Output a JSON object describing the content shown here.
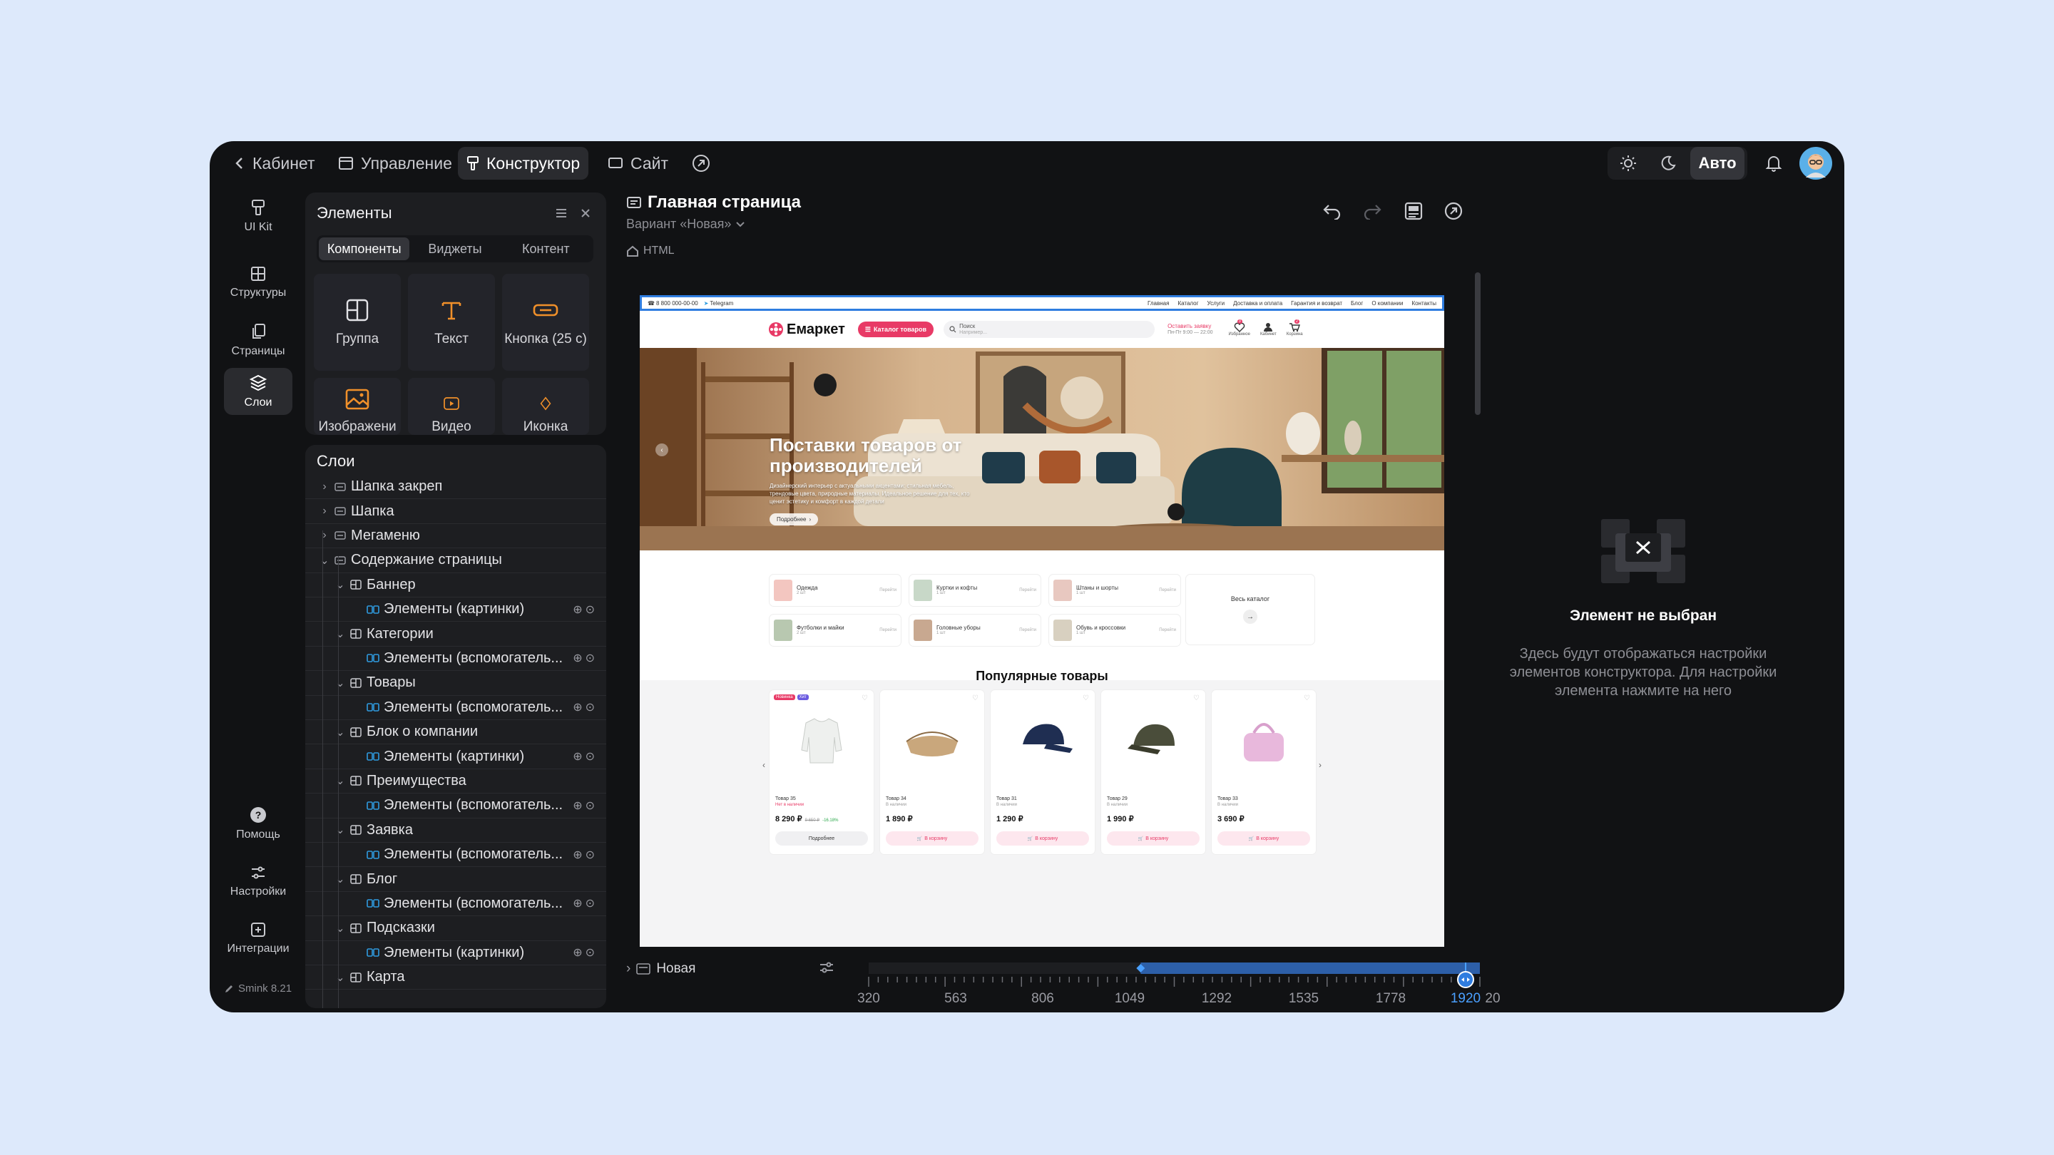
{
  "topbar": {
    "back_label": "Кабинет",
    "nav": [
      {
        "label": "Управление",
        "icon": "window-icon"
      },
      {
        "label": "Конструктор",
        "icon": "brush-icon"
      },
      {
        "label": "Сайт",
        "icon": "monitor-icon"
      }
    ],
    "theme_mode": "Авто"
  },
  "rail": {
    "items": [
      {
        "label": "UI Kit",
        "icon": "brush-icon"
      },
      {
        "label": "Структуры",
        "icon": "grid-icon"
      },
      {
        "label": "Страницы",
        "icon": "pages-icon"
      },
      {
        "label": "Слои",
        "icon": "layers-icon"
      }
    ],
    "bottom_items": [
      {
        "label": "Помощь",
        "icon": "help-icon"
      },
      {
        "label": "Настройки",
        "icon": "sliders-icon"
      },
      {
        "label": "Интеграции",
        "icon": "plus-square-icon"
      }
    ],
    "version": "Smink 8.21"
  },
  "elements_panel": {
    "title": "Элементы",
    "tabs": [
      "Компоненты",
      "Виджеты",
      "Контент"
    ],
    "active_tab": "Компоненты",
    "tiles": [
      {
        "label": "Группа",
        "icon": "group-icon"
      },
      {
        "label": "Текст",
        "icon": "text-icon"
      },
      {
        "label": "Кнопка (25 с)",
        "icon": "button-icon"
      },
      {
        "label": "Изображени",
        "icon": "image-icon"
      },
      {
        "label": "Видео",
        "icon": "video-icon"
      },
      {
        "label": "Иконка",
        "icon": "diamond-icon"
      }
    ]
  },
  "layers_panel": {
    "title": "Слои",
    "items": [
      {
        "label": "Шапка закреп",
        "level": 0,
        "expanded": false
      },
      {
        "label": "Шапка",
        "level": 0,
        "expanded": false
      },
      {
        "label": "Мегаменю",
        "level": 0,
        "expanded": false
      },
      {
        "label": "Содержание страницы",
        "level": 0,
        "expanded": true
      },
      {
        "label": "Баннер",
        "level": 1,
        "expanded": true
      },
      {
        "label": "Элементы (картинки)",
        "level": 2
      },
      {
        "label": "Категории",
        "level": 1,
        "expanded": true
      },
      {
        "label": "Элементы (вспомогатель...",
        "level": 2
      },
      {
        "label": "Товары",
        "level": 1,
        "expanded": true
      },
      {
        "label": "Элементы (вспомогатель...",
        "level": 2
      },
      {
        "label": "Блок о компании",
        "level": 1,
        "expanded": true
      },
      {
        "label": "Элементы (картинки)",
        "level": 2
      },
      {
        "label": "Преимущества",
        "level": 1,
        "expanded": true
      },
      {
        "label": "Элементы (вспомогатель...",
        "level": 2
      },
      {
        "label": "Заявка",
        "level": 1,
        "expanded": true
      },
      {
        "label": "Элементы (вспомогатель...",
        "level": 2
      },
      {
        "label": "Блог",
        "level": 1,
        "expanded": true
      },
      {
        "label": "Элементы (вспомогатель...",
        "level": 2
      },
      {
        "label": "Подсказки",
        "level": 1,
        "expanded": true
      },
      {
        "label": "Элементы (картинки)",
        "level": 2
      },
      {
        "label": "Карта",
        "level": 1,
        "expanded": true
      }
    ]
  },
  "page_header": {
    "title": "Главная страница",
    "variant": "Вариант «Новая»",
    "breadcrumb": "HTML"
  },
  "preview": {
    "topline": {
      "phone": "8 800 000-00-00",
      "telegram": "Telegram",
      "links": [
        "Главная",
        "Каталог",
        "Услуги",
        "Доставка и оплата",
        "Гарантия и возврат",
        "Блог",
        "О компании",
        "Контакты"
      ]
    },
    "header": {
      "logo": "Емаркет",
      "catalog_button": "Каталог товаров",
      "search_placeholder": "Поиск",
      "search_hint": "Например...",
      "request_label": "Оставить заявку",
      "request_hours": "Пн-Пт 9:00 — 22:00",
      "icons": [
        {
          "label": "Избранное",
          "badge": "3"
        },
        {
          "label": "Кабинет"
        },
        {
          "label": "Корзина",
          "badge": "2"
        }
      ]
    },
    "banner": {
      "title": "Поставки товаров от производителей",
      "text": "Дизайнерский интерьер с актуальными акцентами: стильная мебель, трендовые цвета, природные материалы. Идеальное решение для тех, кто ценит эстетику и комфорт в каждой детали",
      "button": "Подробнее"
    },
    "categories": [
      {
        "name": "Одежда",
        "count": "2 шт",
        "link": "Перейти"
      },
      {
        "name": "Куртки и кофты",
        "count": "1 шт",
        "link": "Перейти"
      },
      {
        "name": "Штаны и шорты",
        "count": "1 шт",
        "link": "Перейти"
      },
      {
        "name": "Футболки и майки",
        "count": "2 шт",
        "link": "Перейти"
      },
      {
        "name": "Головные уборы",
        "count": "1 шт",
        "link": "Перейти"
      },
      {
        "name": "Обувь и кроссовки",
        "count": "1 шт",
        "link": "Перейти"
      }
    ],
    "all_catalog": "Весь каталог",
    "popular_title": "Популярные товары",
    "products": [
      {
        "name": "Товар 35",
        "sub": "Нет в наличии",
        "price": "8 290 ₽",
        "old_price": "9 650 ₽",
        "discount": "-16.18%",
        "button": "Подробнее",
        "badges": [
          "Новинка",
          "Хит"
        ],
        "kind": "jacket"
      },
      {
        "name": "Товар 34",
        "sub": "В наличии",
        "price": "1 890 ₽",
        "button": "В корзину",
        "kind": "bag"
      },
      {
        "name": "Товар 31",
        "sub": "В наличии",
        "price": "1 290 ₽",
        "button": "В корзину",
        "kind": "cap-navy"
      },
      {
        "name": "Товар 29",
        "sub": "В наличии",
        "price": "1 990 ₽",
        "button": "В корзину",
        "kind": "cap-olive"
      },
      {
        "name": "Товар 33",
        "sub": "В наличии",
        "price": "3 690 ₽",
        "button": "В корзину",
        "kind": "pink-bag"
      }
    ]
  },
  "right_panel": {
    "empty_title": "Элемент не выбран",
    "empty_text": "Здесь будут отображаться настройки элементов конструктора. Для настройки элемента нажмите на него"
  },
  "bottom_bar": {
    "variant_label": "Новая",
    "ruler_labels": [
      "320",
      "563",
      "806",
      "1049",
      "1292",
      "1535",
      "1778",
      "1920",
      "20"
    ],
    "current_width": "1920",
    "range_start": 1049,
    "range_end": 1920
  },
  "colors": {
    "app_bg": "#111214",
    "panel_bg": "#1d1e21",
    "accent_blue": "#2f7de0",
    "brand_pink": "#e83a66",
    "icon_orange": "#f0902a"
  }
}
